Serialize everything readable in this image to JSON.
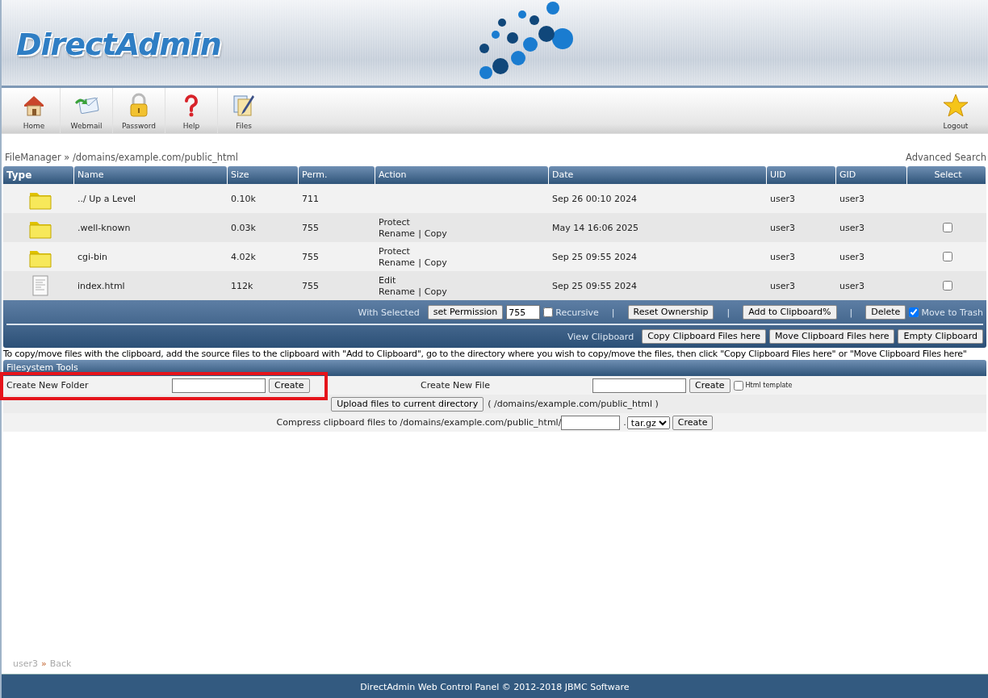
{
  "header": {
    "logo": "DirectAdmin"
  },
  "toolbar": {
    "items": [
      {
        "kind": "home",
        "label": "Home"
      },
      {
        "kind": "mail",
        "label": "Webmail"
      },
      {
        "kind": "lock",
        "label": "Password"
      },
      {
        "kind": "help",
        "label": "Help"
      },
      {
        "kind": "files",
        "label": "Files"
      }
    ],
    "logout": {
      "kind": "star",
      "label": "Logout"
    }
  },
  "breadcrumb": "FileManager » /domains/example.com/public_html",
  "advanced_search": "Advanced Search",
  "table": {
    "columns": [
      "Type",
      "Name",
      "Size",
      "Perm.",
      "Action",
      "Date",
      "UID",
      "GID",
      "Select"
    ],
    "rows": [
      {
        "kind": "folder",
        "name": "../ Up a Level",
        "size": "0.10k",
        "perm": "711",
        "actions": [],
        "date": "Sep 26 00:10 2024",
        "uid": "user3",
        "gid": "user3"
      },
      {
        "kind": "folder",
        "name": ".well-known",
        "size": "0.03k",
        "perm": "755",
        "actions": [
          [
            "Protect"
          ],
          [
            "Rename",
            "|",
            "Copy"
          ]
        ],
        "date": "May 14 16:06 2025",
        "uid": "user3",
        "gid": "user3",
        "checked": false
      },
      {
        "kind": "folder",
        "name": "cgi-bin",
        "size": "4.02k",
        "perm": "755",
        "actions": [
          [
            "Protect"
          ],
          [
            "Rename",
            "|",
            "Copy"
          ]
        ],
        "date": "Sep 25 09:55 2024",
        "uid": "user3",
        "gid": "user3",
        "checked": false
      },
      {
        "kind": "file",
        "name": "index.html",
        "size": "112k",
        "perm": "755",
        "actions": [
          [
            "Edit"
          ],
          [
            "Rename",
            "|",
            "Copy"
          ]
        ],
        "date": "Sep 25 09:55 2024",
        "uid": "user3",
        "gid": "user3",
        "checked": false
      }
    ]
  },
  "with_selected": {
    "items": [
      {
        "kind": "label",
        "text": "With Selected"
      },
      {
        "kind": "button",
        "text": "set Permission"
      },
      {
        "kind": "field",
        "text": "755"
      },
      {
        "kind": "checkbox",
        "text": "Recursive",
        "checked": false
      },
      {
        "kind": "separator",
        "text": "|"
      },
      {
        "kind": "button",
        "text": "Reset Ownership"
      },
      {
        "kind": "separator",
        "text": "|"
      },
      {
        "kind": "button",
        "text": "Add to Clipboard%"
      },
      {
        "kind": "separator",
        "text": "|"
      },
      {
        "kind": "button",
        "text": "Delete"
      },
      {
        "kind": "checkbox",
        "text": "Move to Trash",
        "checked": true
      }
    ]
  },
  "clipboard_bar": {
    "items": [
      {
        "kind": "label",
        "text": "View Clipboard"
      },
      {
        "kind": "button",
        "text": "Copy Clipboard Files here"
      },
      {
        "kind": "button",
        "text": "Move Clipboard Files here"
      },
      {
        "kind": "button",
        "text": "Empty Clipboard"
      }
    ]
  },
  "note": "To copy/move files with the clipboard, add the source files to the clipboard with \"Add to Clipboard\", go to the directory where you wish to copy/move the files, then click \"Copy Clipboard Files here\" or \"Move Clipboard Files here\"",
  "filesystem_tools": {
    "title": "Filesystem Tools",
    "create_folder": {
      "label": "Create New Folder",
      "button": "Create",
      "highlighted": true
    },
    "create_file": {
      "label": "Create New File",
      "button": "Create",
      "template": {
        "label": "Html template",
        "checked": false
      }
    },
    "upload": {
      "button": "Upload files to current directory",
      "path": "( /domains/example.com/public_html )"
    },
    "compress": {
      "label": "Compress clipboard files to /domains/example.com/public_html/",
      "dot": ".",
      "format": "tar.gz",
      "button": "Create"
    }
  },
  "footer_crumb": {
    "user": "user3",
    "separator": "»",
    "back": "Back"
  },
  "footer": "DirectAdmin Web Control Panel © 2012-2018 JBMC Software"
}
